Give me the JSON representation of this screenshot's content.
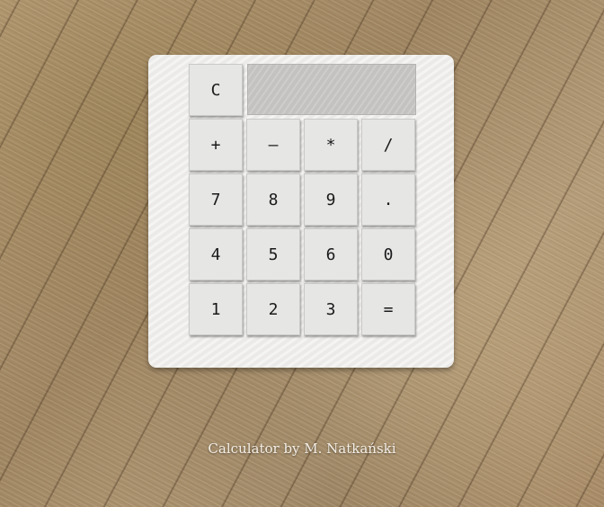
{
  "calculator": {
    "display_value": "",
    "keys": {
      "clear": "C",
      "plus": "+",
      "minus": "–",
      "multiply": "*",
      "divide": "/",
      "seven": "7",
      "eight": "8",
      "nine": "9",
      "dot": ".",
      "four": "4",
      "five": "5",
      "six": "6",
      "zero": "0",
      "one": "1",
      "two": "2",
      "three": "3",
      "equals": "="
    }
  },
  "footer": {
    "credit": "Calculator by M. Natkański"
  }
}
